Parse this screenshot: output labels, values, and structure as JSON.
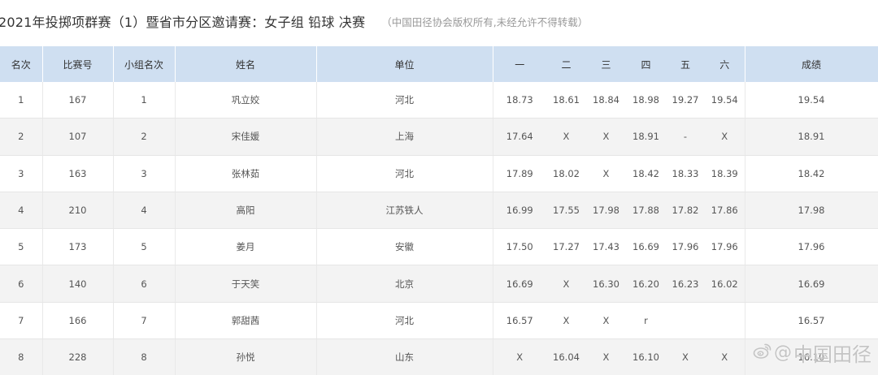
{
  "header": {
    "title": "2021年投掷项群赛（1）暨省市分区邀请赛：女子组 铅球 决赛",
    "copyright": "（中国田径协会版权所有,未经允许不得转载）"
  },
  "table": {
    "columns": [
      "名次",
      "比赛号",
      "小组名次",
      "姓名",
      "单位",
      "一",
      "二",
      "三",
      "四",
      "五",
      "六",
      "成绩"
    ],
    "rows": [
      {
        "rank": "1",
        "bib": "167",
        "group_rank": "1",
        "name": "巩立姣",
        "unit": "河北",
        "a1": "18.73",
        "a2": "18.61",
        "a3": "18.84",
        "a4": "18.98",
        "a5": "19.27",
        "a6": "19.54",
        "result": "19.54"
      },
      {
        "rank": "2",
        "bib": "107",
        "group_rank": "2",
        "name": "宋佳媛",
        "unit": "上海",
        "a1": "17.64",
        "a2": "X",
        "a3": "X",
        "a4": "18.91",
        "a5": "-",
        "a6": "X",
        "result": "18.91"
      },
      {
        "rank": "3",
        "bib": "163",
        "group_rank": "3",
        "name": "张林茹",
        "unit": "河北",
        "a1": "17.89",
        "a2": "18.02",
        "a3": "X",
        "a4": "18.42",
        "a5": "18.33",
        "a6": "18.39",
        "result": "18.42"
      },
      {
        "rank": "4",
        "bib": "210",
        "group_rank": "4",
        "name": "高阳",
        "unit": "江苏铁人",
        "a1": "16.99",
        "a2": "17.55",
        "a3": "17.98",
        "a4": "17.88",
        "a5": "17.82",
        "a6": "17.86",
        "result": "17.98"
      },
      {
        "rank": "5",
        "bib": "173",
        "group_rank": "5",
        "name": "姜月",
        "unit": "安徽",
        "a1": "17.50",
        "a2": "17.27",
        "a3": "17.43",
        "a4": "16.69",
        "a5": "17.96",
        "a6": "17.96",
        "result": "17.96"
      },
      {
        "rank": "6",
        "bib": "140",
        "group_rank": "6",
        "name": "于天笑",
        "unit": "北京",
        "a1": "16.69",
        "a2": "X",
        "a3": "16.30",
        "a4": "16.20",
        "a5": "16.23",
        "a6": "16.02",
        "result": "16.69"
      },
      {
        "rank": "7",
        "bib": "166",
        "group_rank": "7",
        "name": "郭甜茜",
        "unit": "河北",
        "a1": "16.57",
        "a2": "X",
        "a3": "X",
        "a4": "r",
        "a5": "",
        "a6": "",
        "result": "16.57"
      },
      {
        "rank": "8",
        "bib": "228",
        "group_rank": "8",
        "name": "孙悦",
        "unit": "山东",
        "a1": "X",
        "a2": "16.04",
        "a3": "X",
        "a4": "16.10",
        "a5": "X",
        "a6": "X",
        "result": "16.10"
      }
    ]
  },
  "watermark": {
    "at": "@",
    "text": "中国田径",
    "icon": "weibo-icon"
  }
}
